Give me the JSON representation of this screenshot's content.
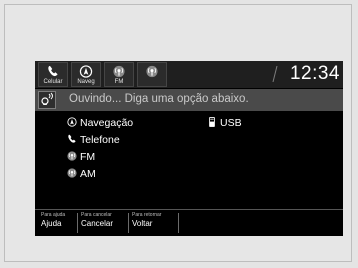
{
  "status_bar": {
    "apps": [
      {
        "label": "Celular",
        "icon": "phone-icon"
      },
      {
        "label": "Naveg",
        "icon": "navigation-icon"
      },
      {
        "label": "FM",
        "icon": "radio-fm-icon"
      },
      {
        "label": "",
        "icon": "radio-am-icon"
      }
    ],
    "time": "12:34"
  },
  "voice_prompt": {
    "icon": "voice-recognition-icon",
    "text": "Ouvindo... Diga uma opção abaixo."
  },
  "options": {
    "navegacao": {
      "label": "Navegação",
      "icon": "navigation-icon"
    },
    "telefone": {
      "label": "Telefone",
      "icon": "phone-icon"
    },
    "fm": {
      "label": "FM",
      "icon": "radio-fm-icon"
    },
    "am": {
      "label": "AM",
      "icon": "radio-am-icon"
    },
    "usb": {
      "label": "USB",
      "icon": "usb-icon"
    }
  },
  "hints": [
    {
      "small": "Para ajuda",
      "big": "Ajuda"
    },
    {
      "small": "Para cancelar",
      "big": "Cancelar"
    },
    {
      "small": "Para retornar",
      "big": "Voltar"
    }
  ]
}
